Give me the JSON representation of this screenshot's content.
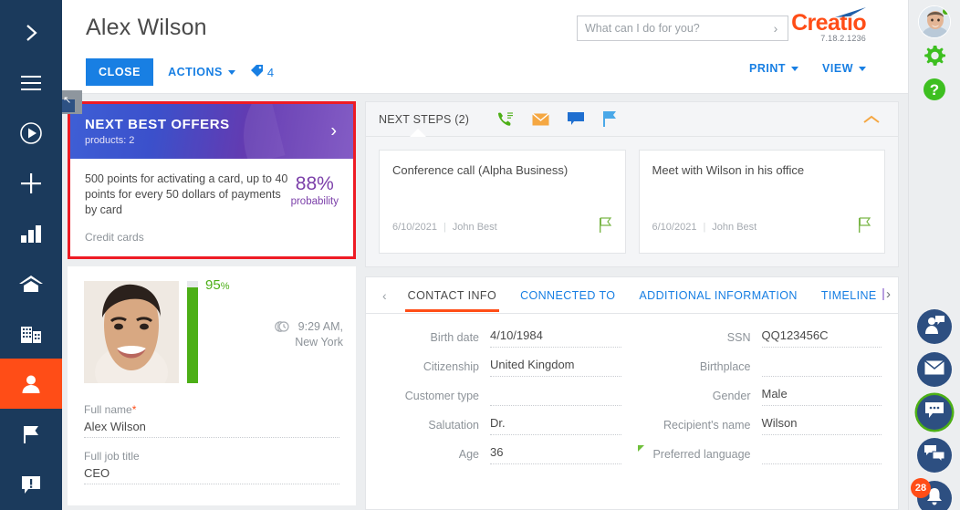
{
  "left_nav": {
    "items": [
      {
        "name": "expand-panel",
        "icon": "chevron-right-icon",
        "active": false
      },
      {
        "name": "menu",
        "icon": "hamburger-menu-icon",
        "active": false
      },
      {
        "name": "run-process",
        "icon": "play-circle-icon",
        "active": false
      },
      {
        "name": "add-record",
        "icon": "plus-icon",
        "active": false
      },
      {
        "name": "dashboards",
        "icon": "bar-chart-icon",
        "active": false
      },
      {
        "name": "home",
        "icon": "home-icon",
        "active": false
      },
      {
        "name": "accounts",
        "icon": "building-icon",
        "active": false
      },
      {
        "name": "contacts",
        "icon": "person-icon",
        "active": true
      },
      {
        "name": "activities",
        "icon": "flag-icon",
        "active": false
      },
      {
        "name": "notifications",
        "icon": "alert-bubble-icon",
        "active": false
      }
    ]
  },
  "header": {
    "page_title": "Alex Wilson",
    "search": {
      "placeholder": "What can I do for you?",
      "value": ""
    },
    "brand": {
      "name": "Creatio",
      "version": "7.18.2.1236"
    },
    "toolbar": {
      "close_label": "CLOSE",
      "actions_label": "ACTIONS",
      "tag_count": "4",
      "print_label": "PRINT",
      "view_label": "VIEW"
    }
  },
  "offer_card": {
    "title": "NEXT BEST OFFERS",
    "subtitle": "products: 2",
    "description": "500 points for activating a card, up to 40 points for every 50 dollars of payments by card",
    "category": "Credit cards",
    "probability_value": "88%",
    "probability_label": "probability",
    "highlight_color": "#ee1b24"
  },
  "profile": {
    "completeness": "95",
    "completeness_unit": "%",
    "time": "9:29 AM,",
    "location": "New York",
    "fields": [
      {
        "label": "Full name",
        "required": true,
        "value": "Alex Wilson"
      },
      {
        "label": "Full job title",
        "required": false,
        "value": "CEO"
      }
    ]
  },
  "next_steps": {
    "title": "NEXT STEPS (2)",
    "icons": [
      {
        "name": "call-icon",
        "color": "#4caf16"
      },
      {
        "name": "email-icon",
        "color": "#f5a742"
      },
      {
        "name": "chat-icon",
        "color": "#1f6fd0"
      },
      {
        "name": "flag-icon",
        "color": "#4aa8e8"
      }
    ],
    "cards": [
      {
        "title": "Conference call (Alpha Business)",
        "date": "6/10/2021",
        "owner": "John Best"
      },
      {
        "title": "Meet with Wilson in his office",
        "date": "6/10/2021",
        "owner": "John Best"
      }
    ]
  },
  "tabs": {
    "items": [
      {
        "label": "CONTACT INFO",
        "active": true
      },
      {
        "label": "CONNECTED TO",
        "active": false
      },
      {
        "label": "ADDITIONAL INFORMATION",
        "active": false
      },
      {
        "label": "TIMELINE",
        "active": false
      }
    ]
  },
  "contact_info": {
    "left": [
      {
        "label": "Birth date",
        "value": "4/10/1984"
      },
      {
        "label": "Citizenship",
        "value": "United Kingdom"
      },
      {
        "label": "Customer type",
        "value": ""
      },
      {
        "label": "Salutation",
        "value": "Dr."
      },
      {
        "label": "Age",
        "value": "36"
      }
    ],
    "right": [
      {
        "label": "SSN",
        "value": "QQ123456C",
        "flag": false
      },
      {
        "label": "Birthplace",
        "value": "",
        "flag": false
      },
      {
        "label": "Gender",
        "value": "Male",
        "flag": false
      },
      {
        "label": "Recipient's name",
        "value": "Wilson",
        "flag": false
      },
      {
        "label": "Preferred language",
        "value": "",
        "flag": true
      }
    ]
  },
  "right_rail": {
    "top": [
      {
        "name": "user-avatar",
        "icon": "avatar-icon"
      },
      {
        "name": "settings",
        "icon": "gear-icon"
      },
      {
        "name": "help",
        "icon": "question-circle-icon"
      }
    ],
    "bottom": [
      {
        "name": "feed",
        "icon": "person-chat-icon",
        "badge": ""
      },
      {
        "name": "email",
        "icon": "envelope-icon",
        "badge": ""
      },
      {
        "name": "chat",
        "icon": "chat-bubble-icon",
        "badge": ""
      },
      {
        "name": "messages",
        "icon": "two-bubbles-icon",
        "badge": ""
      },
      {
        "name": "notifications",
        "icon": "bell-icon",
        "badge": "28"
      }
    ]
  }
}
